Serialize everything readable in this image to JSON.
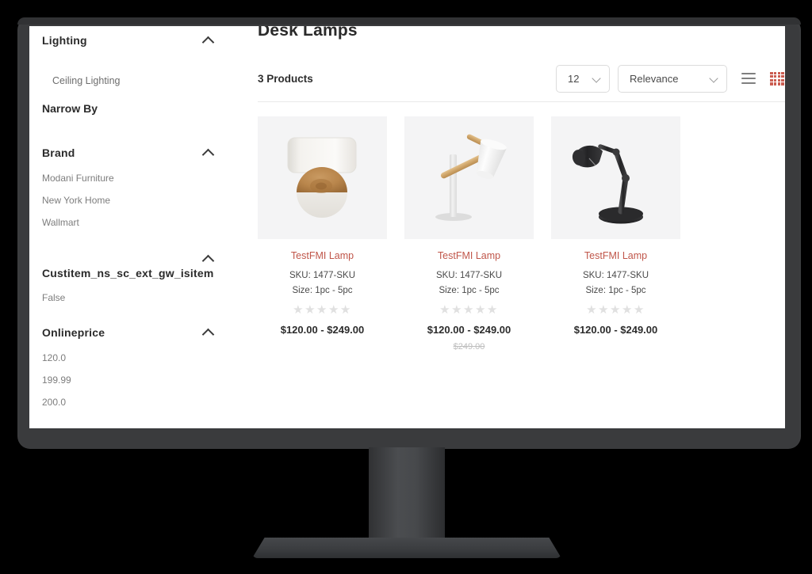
{
  "device": {
    "type": "desktop-monitor"
  },
  "sidebar": {
    "category": {
      "label": "Lighting",
      "expanded": true,
      "chevron_icon": "chevron-up-icon"
    },
    "subcategories": [
      {
        "label": "Ceiling Lighting"
      }
    ],
    "narrow_by_label": "Narrow By",
    "facets": [
      {
        "title": "Brand",
        "expanded": true,
        "chevron_icon": "chevron-up-icon",
        "options": [
          "Modani Furniture",
          "New York Home",
          "Wallmart"
        ]
      },
      {
        "title": "Custitem_ns_sc_ext_gw_isitem",
        "expanded": true,
        "chevron_icon": "chevron-up-icon",
        "options": [
          "False"
        ]
      },
      {
        "title": "Onlineprice",
        "expanded": true,
        "chevron_icon": "chevron-up-icon",
        "options": [
          "120.0",
          "199.99",
          "200.0"
        ]
      }
    ]
  },
  "main": {
    "page_title": "Desk Lamps",
    "product_count_label": "3 Products",
    "per_page": {
      "value": "12",
      "caret_icon": "chevron-down-icon"
    },
    "sort": {
      "value": "Relevance",
      "caret_icon": "chevron-down-icon"
    },
    "view_modes": [
      {
        "name": "list-view",
        "icon": "list-view-icon",
        "active": false,
        "color": "#7f7f7f"
      },
      {
        "name": "dense-grid-view",
        "icon": "grid-4x4-icon",
        "active": true,
        "color": "#c0392b"
      },
      {
        "name": "large-grid-view",
        "icon": "grid-2x2-icon",
        "active": false,
        "color": "#c9c9c9"
      }
    ],
    "products": [
      {
        "name": "TestFMI Lamp",
        "sku": "SKU: 1477-SKU",
        "size": "Size: 1pc - 5pc",
        "stars": "★★★★★",
        "rating": 0,
        "price": "$120.00 - $249.00",
        "old_price": "",
        "image": "white-shade-table-lamp"
      },
      {
        "name": "TestFMI Lamp",
        "sku": "SKU: 1477-SKU",
        "size": "Size: 1pc - 5pc",
        "stars": "★★★★★",
        "rating": 0,
        "price": "$120.00 - $249.00",
        "old_price": "$249.00",
        "image": "wood-arm-desk-lamp"
      },
      {
        "name": "TestFMI Lamp",
        "sku": "SKU: 1477-SKU",
        "size": "Size: 1pc - 5pc",
        "stars": "★★★★★",
        "rating": 0,
        "price": "$120.00 - $249.00",
        "old_price": "",
        "image": "black-architect-desk-lamp"
      }
    ]
  },
  "colors": {
    "accent": "#c0392b",
    "product_name": "#c0564a",
    "text": "#2b2b2b",
    "muted": "#7d7d7d",
    "tile_bg": "#f4f4f5",
    "bezel": "#3a3b3d"
  }
}
